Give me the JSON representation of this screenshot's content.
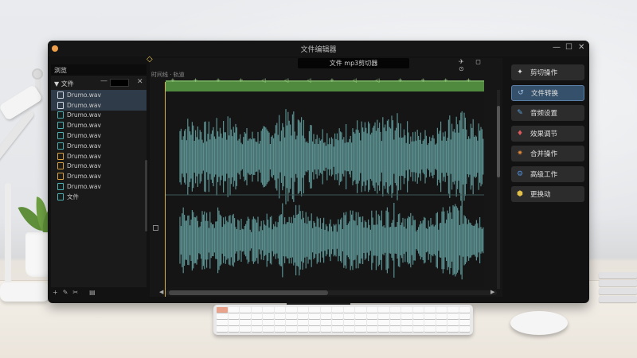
{
  "window": {
    "title": "文件编辑器",
    "controls": [
      "—",
      "☐",
      "✕"
    ]
  },
  "sidebar": {
    "header": "浏览",
    "folder_label": "▼ 文件",
    "search_dash": "—",
    "close_x": "✕",
    "files": [
      {
        "label": "Drumo.wav",
        "selected": true,
        "color": "#cfd8e3"
      },
      {
        "label": "Drumo.wav",
        "selected": true,
        "color": "#cfd8e3"
      },
      {
        "label": "Drumo.wav",
        "selected": false,
        "color": "#4fb3b3"
      },
      {
        "label": "Drumo.wav",
        "selected": false,
        "color": "#4fb3b3"
      },
      {
        "label": "Drumo.wav",
        "selected": false,
        "color": "#4fb3b3"
      },
      {
        "label": "Drumo.wav",
        "selected": false,
        "color": "#4fb3b3"
      },
      {
        "label": "Drumo.wav",
        "selected": false,
        "color": "#d9a441"
      },
      {
        "label": "Drumo.wav",
        "selected": false,
        "color": "#d9a441"
      },
      {
        "label": "Drumo.wav",
        "selected": false,
        "color": "#d9a441"
      },
      {
        "label": "Drumo.wav",
        "selected": false,
        "color": "#4fb3b3"
      },
      {
        "label": "文件",
        "selected": false,
        "color": "#4fb3b3"
      }
    ],
    "bottom_icons": [
      "+",
      "✎",
      "✂",
      "▤"
    ]
  },
  "editor": {
    "doc_title": "文件 mp3剪切器",
    "top_icons": [
      "✈",
      "◻",
      "⊙"
    ],
    "timeline_label": "时间线 · 轨道",
    "ruler_marks": [
      "+",
      "+",
      "+",
      "+",
      "◁",
      "◁",
      "◁",
      "+",
      "◁",
      "◁",
      "+",
      "+",
      "+",
      "+"
    ],
    "waveform_color": "#5b8e8e"
  },
  "panel": {
    "buttons": [
      {
        "label": "剪切操作",
        "icon": "✦",
        "color": "#dddddd",
        "active": false
      },
      {
        "label": "文件转换",
        "icon": "↺",
        "color": "#9fc3ea",
        "active": true
      },
      {
        "label": "音频设置",
        "icon": "✎",
        "color": "#5aa0d8",
        "active": false
      },
      {
        "label": "效果调节",
        "icon": "♦",
        "color": "#e0585a",
        "active": false
      },
      {
        "label": "合并操作",
        "icon": "✷",
        "color": "#e88b3a",
        "active": false
      },
      {
        "label": "高级工作",
        "icon": "⚙",
        "color": "#4f8fd8",
        "active": false
      },
      {
        "label": "更换动",
        "icon": "⬢",
        "color": "#e3c04a",
        "active": false
      }
    ]
  }
}
